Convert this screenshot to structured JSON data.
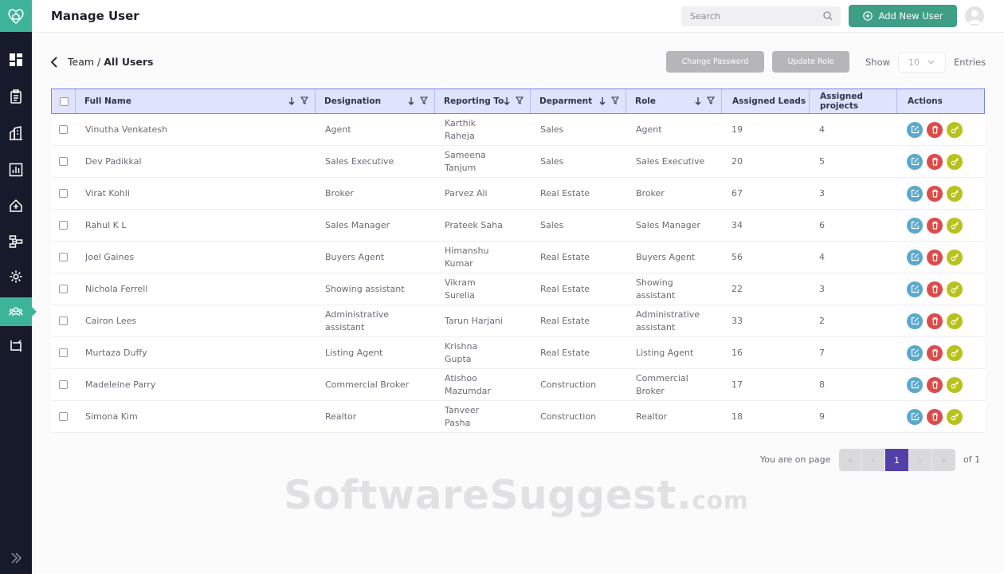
{
  "header": {
    "title": "Manage User",
    "search_placeholder": "Search",
    "add_button": "Add New User"
  },
  "sidebar": {
    "items": [
      {
        "icon": "dashboard-icon"
      },
      {
        "icon": "clipboard-icon"
      },
      {
        "icon": "buildings-icon"
      },
      {
        "icon": "bar-chart-icon"
      },
      {
        "icon": "house-add-icon"
      },
      {
        "icon": "workflow-icon"
      },
      {
        "icon": "gear-icon"
      },
      {
        "icon": "team-icon",
        "active": true
      },
      {
        "icon": "transfer-icon"
      }
    ],
    "expand_icon": "double-chevron-right-icon"
  },
  "toolbar": {
    "breadcrumb_parent": "Team",
    "breadcrumb_separator": "/",
    "breadcrumb_current": "All Users",
    "change_password": "Change Password",
    "update_role": "Update Role",
    "show_label": "Show",
    "entries_value": "10",
    "entries_label": "Entries"
  },
  "table": {
    "columns": [
      "Full Name",
      "Designation",
      "Reporting To",
      "Deparment",
      "Role",
      "Assigned Leads",
      "Assigned projects",
      "Actions"
    ],
    "rows": [
      {
        "name": "Vinutha Venkatesh",
        "designation": "Agent",
        "reporting": "Karthik Raheja",
        "department": "Sales",
        "role": "Agent",
        "leads": "19",
        "projects": "4"
      },
      {
        "name": "Dev Padikkal",
        "designation": "Sales Executive",
        "reporting": "Sameena Tanjum",
        "department": "Sales",
        "role": "Sales Executive",
        "leads": "20",
        "projects": "5"
      },
      {
        "name": "Virat Kohli",
        "designation": "Broker",
        "reporting": "Parvez Ali",
        "department": "Real Estate",
        "role": "Broker",
        "leads": "67",
        "projects": "3"
      },
      {
        "name": "Rahul K L",
        "designation": "Sales Manager",
        "reporting": "Prateek Saha",
        "department": "Sales",
        "role": "Sales Manager",
        "leads": "34",
        "projects": "6"
      },
      {
        "name": "Joel Gaines",
        "designation": "Buyers Agent",
        "reporting": "Himanshu Kumar",
        "department": "Real Estate",
        "role": "Buyers Agent",
        "leads": "56",
        "projects": "4"
      },
      {
        "name": "Nichola Ferrell",
        "designation": "Showing assistant",
        "reporting": "Vikram Surelia",
        "department": "Real Estate",
        "role": "Showing assistant",
        "leads": "22",
        "projects": "3"
      },
      {
        "name": "Cairon Lees",
        "designation": "Administrative assistant",
        "reporting": "Tarun Harjani",
        "department": "Real Estate",
        "role": "Administrative assistant",
        "leads": "33",
        "projects": "2"
      },
      {
        "name": "Murtaza Duffy",
        "designation": "Listing Agent",
        "reporting": "Krishna Gupta",
        "department": "Real Estate",
        "role": "Listing Agent",
        "leads": "16",
        "projects": "7"
      },
      {
        "name": "Madeleine Parry",
        "designation": "Commercial Broker",
        "reporting": "Atishoo Mazumdar",
        "department": "Construction",
        "role": "Commercial Broker",
        "leads": "17",
        "projects": "8"
      },
      {
        "name": "Simona Kim",
        "designation": "Realtor",
        "reporting": "Tanveer Pasha",
        "department": "Construction",
        "role": "Realtor",
        "leads": "18",
        "projects": "9"
      }
    ]
  },
  "pagination": {
    "label": "You are on page",
    "current": "1",
    "of_label": "of 1",
    "first": "«",
    "prev": "‹",
    "next": "›",
    "last": "»"
  },
  "watermark": {
    "main": "SoftwareSuggest.",
    "suffix": "com"
  },
  "colors": {
    "sidebar": "#171a2b",
    "accent": "#3db49a",
    "primary_button": "#3f9f86",
    "header_row": "#dfe3fb",
    "header_border": "#7a85e8",
    "page_active": "#5240a8",
    "edit": "#5aa8cd",
    "delete": "#dd4b4b",
    "key": "#b7c21c"
  }
}
